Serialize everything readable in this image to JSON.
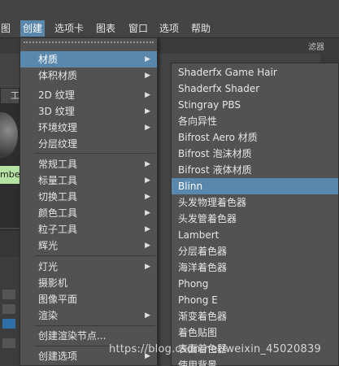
{
  "menubar": {
    "items": [
      "图",
      "创建",
      "选项卡",
      "图表",
      "窗口",
      "选项",
      "帮助"
    ],
    "active_index": 1
  },
  "background": {
    "filter_label": "滤器",
    "tab_label": "工",
    "chip_label": "mbe"
  },
  "create_menu": {
    "items": [
      {
        "label": "材质",
        "submenu": true
      },
      {
        "label": "体积材质",
        "submenu": true
      },
      {
        "label": "2D 纹理",
        "submenu": true
      },
      {
        "label": "3D 纹理",
        "submenu": true
      },
      {
        "label": "环境纹理",
        "submenu": true
      },
      {
        "label": "分层纹理",
        "submenu": false
      },
      {
        "label": "常规工具",
        "submenu": true
      },
      {
        "label": "标量工具",
        "submenu": true
      },
      {
        "label": "切换工具",
        "submenu": true
      },
      {
        "label": "颜色工具",
        "submenu": true
      },
      {
        "label": "粒子工具",
        "submenu": true
      },
      {
        "label": "辉光",
        "submenu": true
      },
      {
        "label": "灯光",
        "submenu": true
      },
      {
        "label": "摄影机",
        "submenu": false
      },
      {
        "label": "图像平面",
        "submenu": false
      },
      {
        "label": "渲染",
        "submenu": true
      },
      {
        "label": "创建渲染节点...",
        "submenu": false
      },
      {
        "label": "创建选项",
        "submenu": true
      }
    ],
    "highlighted": "材质"
  },
  "materials_submenu": {
    "items": [
      "Shaderfx Game Hair",
      "Shaderfx Shader",
      "Stingray PBS",
      "各向异性",
      "Bifrost Aero 材质",
      "Bifrost 泡沫材质",
      "Bifrost 液体材质",
      "Blinn",
      "头发物理着色器",
      "头发管着色器",
      "Lambert",
      "分层着色器",
      "海洋着色器",
      "Phong",
      "Phong E",
      "渐变着色器",
      "着色贴图",
      "表面着色器",
      "使用背景"
    ],
    "highlighted": "Blinn"
  },
  "watermark": "https://blog.csdn.net/weixin_45020839",
  "colors": {
    "highlight": "#5a87ac",
    "menu_bg": "#525252",
    "app_bg": "#444444",
    "chip": "#b6e3a3"
  }
}
